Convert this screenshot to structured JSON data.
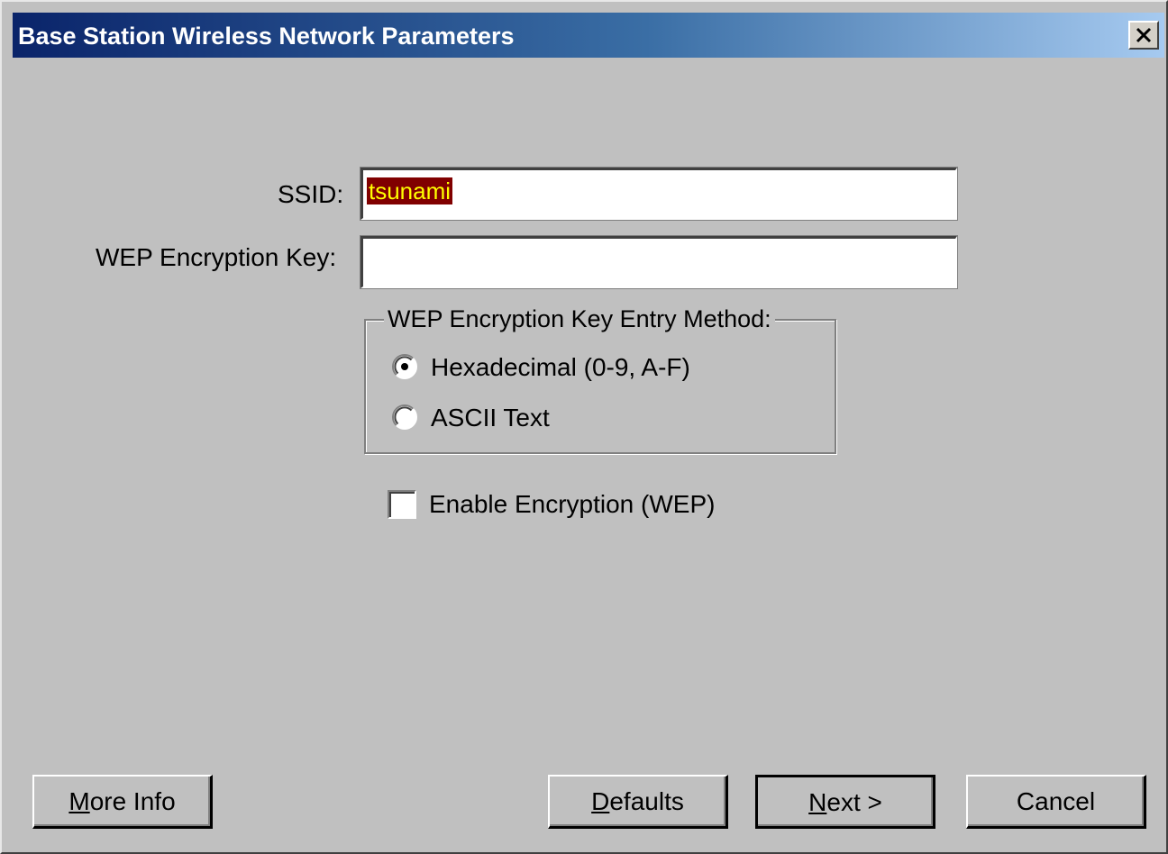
{
  "window": {
    "title": "Base Station Wireless Network Parameters",
    "close_symbol": "✕",
    "close_icon": "close-icon"
  },
  "form": {
    "ssid_label": "SSID:",
    "ssid_value": "tsunami",
    "wep_key_label": "WEP Encryption Key:",
    "wep_key_value": ""
  },
  "entry_method": {
    "legend": "WEP Encryption Key Entry Method:",
    "options": [
      {
        "label": "Hexadecimal (0-9, A-F)",
        "selected": true
      },
      {
        "label": "ASCII Text",
        "selected": false
      }
    ]
  },
  "encryption": {
    "checkbox_label": "Enable Encryption (WEP)",
    "checked": false
  },
  "buttons": {
    "more_info": {
      "mnemonic": "M",
      "rest": "ore Info"
    },
    "defaults": {
      "mnemonic": "D",
      "rest": "efaults"
    },
    "next": {
      "mnemonic": "N",
      "rest": "ext >"
    },
    "cancel": {
      "label": "Cancel"
    }
  },
  "colors": {
    "title_gradient_start": "#0a246a",
    "title_gradient_end": "#a6caf0",
    "dialog_face": "#c0c0c0",
    "selection_background": "#800000",
    "selection_text": "#ffff00"
  }
}
